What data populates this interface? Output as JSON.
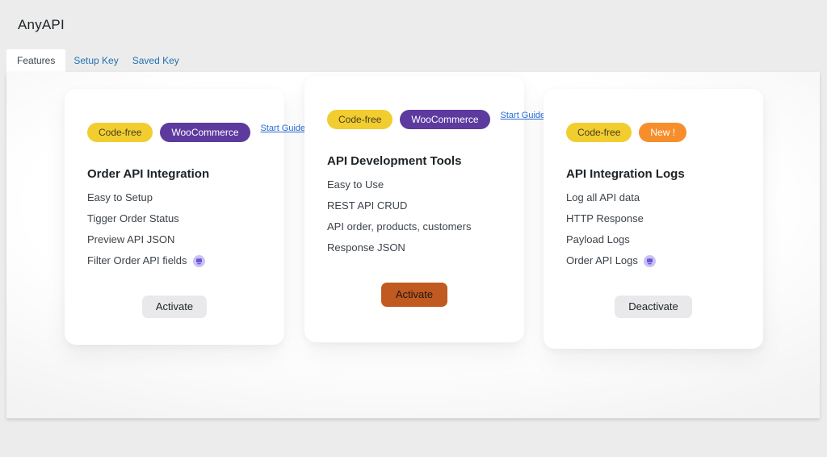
{
  "header": {
    "title": "AnyAPI"
  },
  "tabs": [
    {
      "label": "Features",
      "active": true
    },
    {
      "label": "Setup Key",
      "active": false
    },
    {
      "label": "Saved Key",
      "active": false
    }
  ],
  "cards": [
    {
      "badges": [
        {
          "label": "Code-free"
        },
        {
          "label": "WooCommerce"
        }
      ],
      "link_label": "Start Guide",
      "title": "Order API Integration",
      "features": [
        "Easy to Setup",
        "Tigger Order Status",
        "Preview API JSON",
        "Filter Order API fields"
      ],
      "button_label": "Activate"
    },
    {
      "badges": [
        {
          "label": "Code-free"
        },
        {
          "label": "WooCommerce"
        }
      ],
      "link_label": "Start Guide",
      "title": "API Development Tools",
      "features": [
        "Easy to Use",
        "REST API CRUD",
        "API order, products, customers",
        "Response JSON"
      ],
      "button_label": "Activate"
    },
    {
      "badges": [
        {
          "label": "Code-free"
        },
        {
          "label": "New !"
        }
      ],
      "title": "API Integration Logs",
      "features": [
        "Log all API data",
        "HTTP Response",
        "Payload Logs",
        "Order API Logs"
      ],
      "button_label": "Deactivate"
    }
  ],
  "colors": {
    "badge_yellow": "#f2cd30",
    "badge_purple": "#5d3a9e",
    "badge_orange": "#f78e2c",
    "button_orange": "#c05a20",
    "link_blue": "#2271b1",
    "guide_blue": "#2b6cd9"
  }
}
